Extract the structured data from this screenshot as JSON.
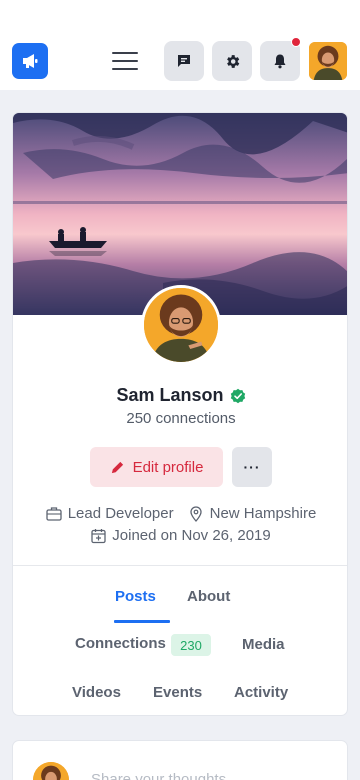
{
  "topbar": {
    "logo_icon": "megaphone-icon",
    "menu_icon": "hamburger-menu-icon",
    "messages_icon": "chat-icon",
    "settings_icon": "gear-icon",
    "notifications_icon": "bell-icon",
    "brand_color": "#1d6ff2",
    "notification_dot_color": "#e0253b"
  },
  "profile": {
    "name": "Sam Lanson",
    "verified_icon": "verified-check-icon",
    "connections_text": "250 connections",
    "edit_label": "Edit profile",
    "more_label": "···",
    "job_title": "Lead Developer",
    "location": "New Hampshire",
    "joined": "Joined on Nov 26, 2019"
  },
  "tabs": {
    "posts": "Posts",
    "about": "About",
    "connections": "Connections",
    "connections_count": "230",
    "media": "Media",
    "videos": "Videos",
    "events": "Events",
    "activity": "Activity",
    "active": "Posts"
  },
  "composer": {
    "placeholder": "Share your thoughts..."
  }
}
